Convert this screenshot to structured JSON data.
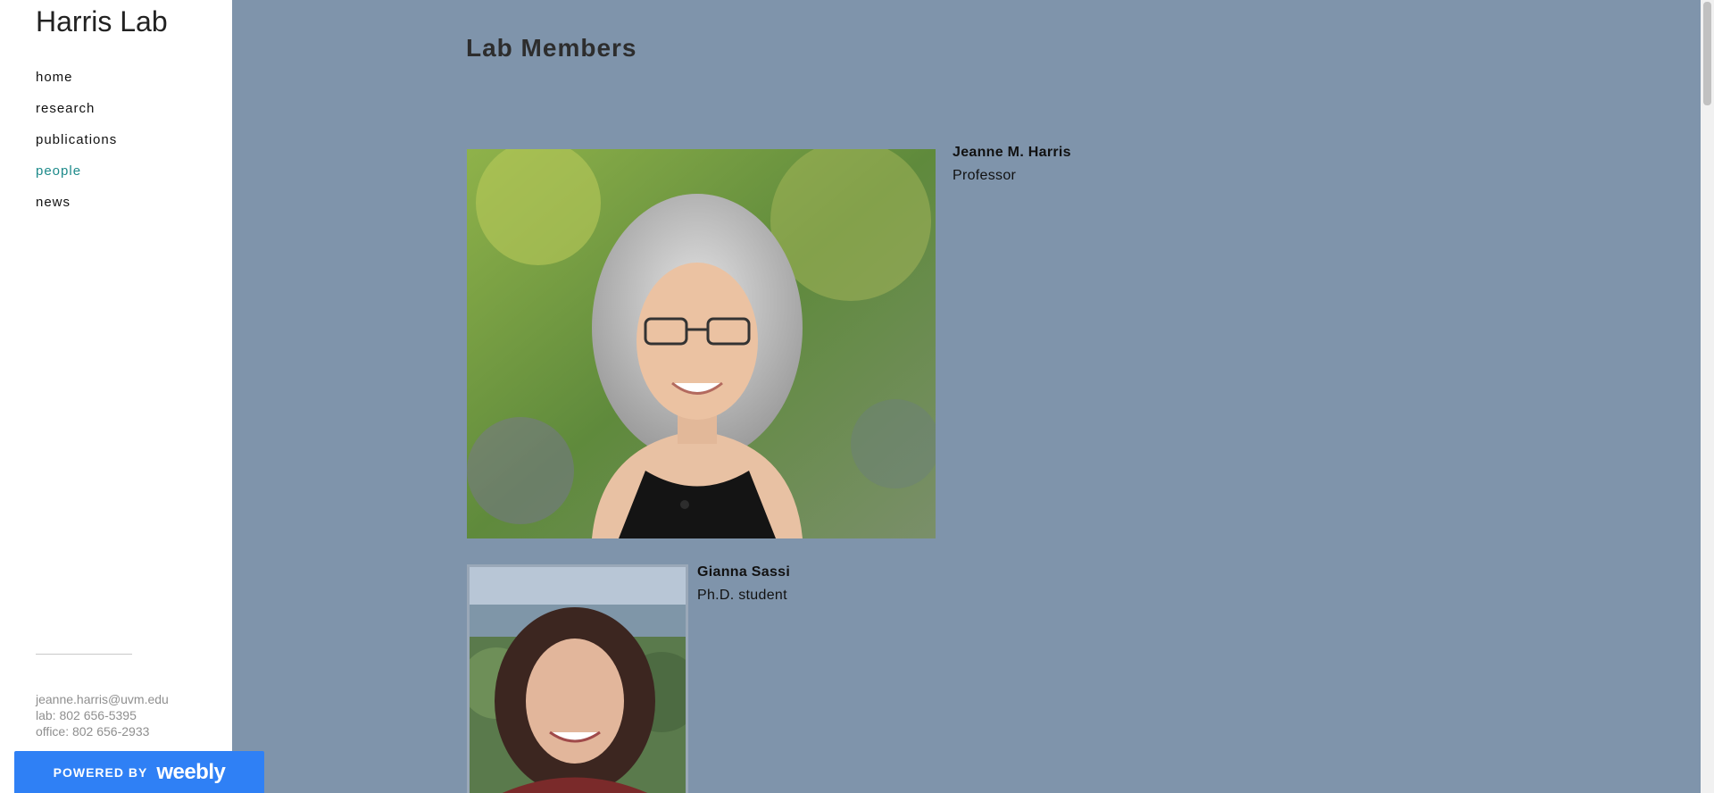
{
  "sidebar": {
    "site_title": "Harris Lab",
    "nav": [
      {
        "label": "home",
        "active": false
      },
      {
        "label": "research",
        "active": false
      },
      {
        "label": "publications",
        "active": false
      },
      {
        "label": "people",
        "active": true
      },
      {
        "label": "news",
        "active": false
      }
    ],
    "contact": {
      "email": "jeanne.harris@uvm.edu",
      "lab": "lab: 802 656-5395",
      "office": "office: 802 656-2933"
    },
    "badge": {
      "powered": "POWERED BY",
      "brand": "weebly"
    }
  },
  "main": {
    "title": "Lab Members",
    "members": [
      {
        "name": "Jeanne M. Harris",
        "role": "Professor",
        "photo_icon": "portrait-photo"
      },
      {
        "name": "Gianna Sassi",
        "role": "Ph.D. student",
        "photo_icon": "portrait-photo"
      }
    ]
  },
  "colors": {
    "page_bg": "#7f94ab",
    "sidebar_bg": "#ffffff",
    "nav_active": "#1d8a8a",
    "badge_bg": "#2f80f5"
  }
}
